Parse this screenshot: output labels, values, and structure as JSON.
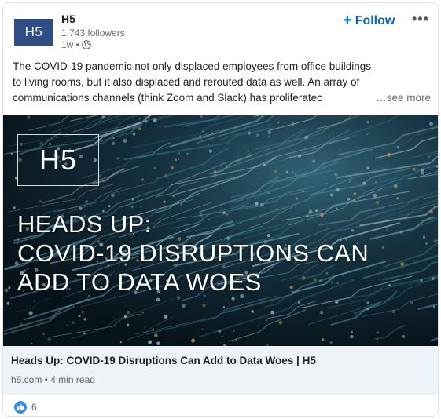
{
  "post": {
    "company_logo_text": "H5",
    "company_name": "H5",
    "followers": "1,743 followers",
    "time": "1w •",
    "follow_label": "Follow",
    "follow_plus": "+",
    "more_icon": "•••",
    "text_lines": [
      "The COVID-19 pandemic not only displaced employees from office buildings",
      "to living rooms, but it also displaced and rerouted data as well. An array of",
      "communications channels (think Zoom and Slack) has proliferatec"
    ],
    "see_more": "…see more"
  },
  "hero": {
    "logo_text": "H5",
    "headline_lines": [
      "HEADS UP:",
      "COVID-19 DISRUPTIONS CAN",
      "ADD TO DATA WOES"
    ]
  },
  "link_preview": {
    "title": "Heads Up: COVID-19 Disruptions Can Add to Data Woes | H5",
    "meta": "h5.com • 4 min read"
  },
  "social": {
    "reaction_count": "6",
    "reaction_icon": "like-icon"
  },
  "colors": {
    "brand": "#2f4d87",
    "accent": "#0a66c2",
    "link_bg": "#eef3f8",
    "like": "#378fe9"
  }
}
